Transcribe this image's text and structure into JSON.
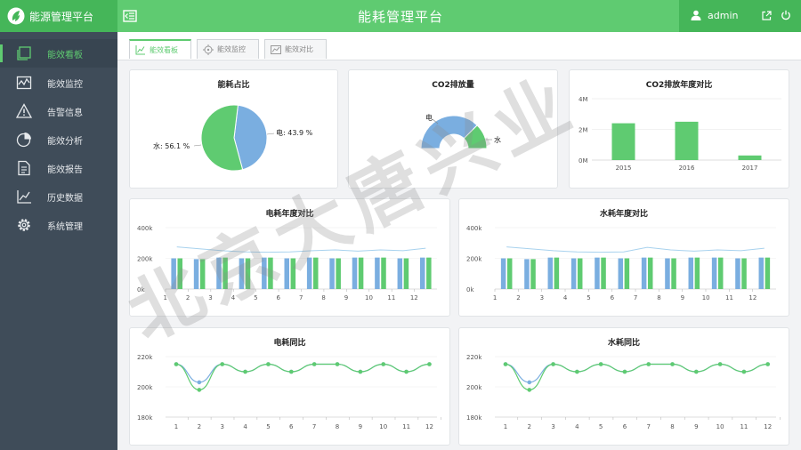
{
  "app": {
    "logo_text": "能源管理平台",
    "page_title": "能耗管理平台"
  },
  "user": {
    "name": "admin"
  },
  "sidebar": {
    "items": [
      {
        "label": "能效看板",
        "icon": "dashboard-icon",
        "active": true
      },
      {
        "label": "能效监控",
        "icon": "monitor-icon",
        "active": false
      },
      {
        "label": "告警信息",
        "icon": "alert-icon",
        "active": false
      },
      {
        "label": "能效分析",
        "icon": "pie-chart-icon",
        "active": false
      },
      {
        "label": "能效报告",
        "icon": "report-icon",
        "active": false
      },
      {
        "label": "历史数据",
        "icon": "trend-icon",
        "active": false
      },
      {
        "label": "系统管理",
        "icon": "settings-icon",
        "active": false
      }
    ]
  },
  "tabs": [
    {
      "label": "能效看板",
      "icon": "line-chart-icon",
      "active": true
    },
    {
      "label": "能效监控",
      "icon": "target-icon",
      "active": false
    },
    {
      "label": "能效对比",
      "icon": "compare-chart-icon",
      "active": false
    }
  ],
  "colors": {
    "green": "#5fcb71",
    "dark_green": "#45b659",
    "blue": "#7aaee0",
    "sidebar": "#3f4c59",
    "line_blue": "#a8d2ee"
  },
  "watermark": "北京大唐兴业",
  "chart_data": [
    {
      "type": "pie",
      "title": "能耗占比",
      "slices": [
        {
          "label": "水: 56.1 %",
          "value": 56.1,
          "color": "#5fcb71"
        },
        {
          "label": "电: 43.9 %",
          "value": 43.9,
          "color": "#7aaee0"
        }
      ]
    },
    {
      "type": "pie",
      "title": "CO2排放量",
      "donut": true,
      "half": true,
      "slices": [
        {
          "label": "电",
          "value": 75,
          "color": "#7aaee0"
        },
        {
          "label": "水",
          "value": 25,
          "color": "#5fcb71"
        }
      ]
    },
    {
      "type": "bar",
      "title": "CO2排放年度对比",
      "categories": [
        "2015",
        "2016",
        "2017"
      ],
      "values": [
        2.4,
        2.5,
        0.3
      ],
      "yticks": [
        "0M",
        "2M",
        "4M"
      ],
      "ylim": [
        0,
        4
      ]
    },
    {
      "type": "bar",
      "title": "电耗年度对比",
      "categories": [
        "1",
        "2",
        "3",
        "4",
        "5",
        "6",
        "7",
        "8",
        "9",
        "10",
        "11",
        "12"
      ],
      "yticks": [
        "0k",
        "200k",
        "400k"
      ],
      "ylim": [
        0,
        400
      ],
      "series": [
        {
          "values": [
            200,
            195,
            205,
            200,
            205,
            200,
            205,
            200,
            205,
            205,
            200,
            205
          ],
          "color": "#7aaee0"
        },
        {
          "values": [
            200,
            195,
            205,
            200,
            205,
            200,
            205,
            200,
            205,
            205,
            200,
            205
          ],
          "color": "#5fcb71"
        }
      ],
      "line": {
        "values": [
          275,
          262,
          250,
          242,
          240,
          242,
          250,
          255,
          247,
          255,
          250,
          266
        ],
        "color": "#a8d2ee"
      }
    },
    {
      "type": "bar",
      "title": "水耗年度对比",
      "categories": [
        "1",
        "2",
        "3",
        "4",
        "5",
        "6",
        "7",
        "8",
        "9",
        "10",
        "11",
        "12"
      ],
      "yticks": [
        "0k",
        "200k",
        "400k"
      ],
      "ylim": [
        0,
        400
      ],
      "series": [
        {
          "values": [
            200,
            195,
            205,
            200,
            205,
            200,
            205,
            200,
            205,
            205,
            200,
            205
          ],
          "color": "#7aaee0"
        },
        {
          "values": [
            200,
            195,
            205,
            200,
            205,
            200,
            205,
            200,
            205,
            205,
            200,
            205
          ],
          "color": "#5fcb71"
        }
      ],
      "line": {
        "values": [
          275,
          262,
          250,
          242,
          240,
          242,
          272,
          255,
          247,
          255,
          250,
          266
        ],
        "color": "#a8d2ee"
      }
    },
    {
      "type": "line",
      "title": "电耗同比",
      "categories": [
        "1",
        "2",
        "3",
        "4",
        "5",
        "6",
        "7",
        "8",
        "9",
        "10",
        "11",
        "12"
      ],
      "yticks": [
        "180k",
        "200k",
        "220k"
      ],
      "ylim": [
        180,
        220
      ],
      "series": [
        {
          "values": [
            215,
            203,
            215,
            210,
            215,
            210,
            215,
            215,
            210,
            215,
            210,
            215
          ],
          "color": "#7aaee0"
        },
        {
          "values": [
            215,
            198,
            215,
            210,
            215,
            210,
            215,
            215,
            210,
            215,
            210,
            215
          ],
          "color": "#5fcb71"
        }
      ]
    },
    {
      "type": "line",
      "title": "水耗同比",
      "categories": [
        "1",
        "2",
        "3",
        "4",
        "5",
        "6",
        "7",
        "8",
        "9",
        "10",
        "11",
        "12"
      ],
      "yticks": [
        "180k",
        "200k",
        "220k"
      ],
      "ylim": [
        180,
        220
      ],
      "series": [
        {
          "values": [
            215,
            203,
            215,
            210,
            215,
            210,
            215,
            215,
            210,
            215,
            210,
            215
          ],
          "color": "#7aaee0"
        },
        {
          "values": [
            215,
            198,
            215,
            210,
            215,
            210,
            215,
            215,
            210,
            215,
            210,
            215
          ],
          "color": "#5fcb71"
        }
      ]
    }
  ]
}
